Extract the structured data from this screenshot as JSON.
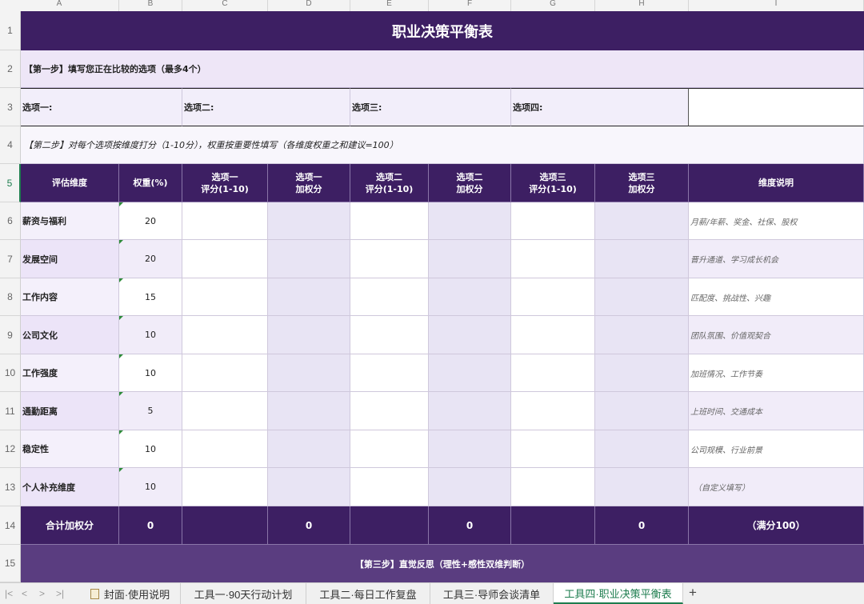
{
  "columns": [
    "A",
    "B",
    "C",
    "D",
    "E",
    "F",
    "G",
    "H",
    "I"
  ],
  "rows": [
    "1",
    "2",
    "3",
    "4",
    "5",
    "6",
    "7",
    "8",
    "9",
    "10",
    "11",
    "12",
    "13",
    "14",
    "15"
  ],
  "title": "职业决策平衡表",
  "step1": "【第一步】填写您正在比较的选项（最多4个）",
  "options": [
    "选项一:",
    "选项二:",
    "选项三:",
    "选项四:"
  ],
  "step2": "【第二步】对每个选项按维度打分（1-10分），权重按重要性填写（各维度权重之和建议=100）",
  "headers": {
    "dimension": "评估维度",
    "weight": "权重(%)",
    "opt1_score": "选项一\n评分(1-10)",
    "opt1_weighted": "选项一\n加权分",
    "opt2_score": "选项二\n评分(1-10)",
    "opt2_weighted": "选项二\n加权分",
    "opt3_score": "选项三\n评分(1-10)",
    "opt3_weighted": "选项三\n加权分",
    "description": "维度说明"
  },
  "dimensions": [
    {
      "name": "薪资与福利",
      "weight": "20",
      "desc": "月薪/年薪、奖金、社保、股权"
    },
    {
      "name": "发展空间",
      "weight": "20",
      "desc": "晋升通道、学习成长机会"
    },
    {
      "name": "工作内容",
      "weight": "15",
      "desc": "匹配度、挑战性、兴趣"
    },
    {
      "name": "公司文化",
      "weight": "10",
      "desc": "团队氛围、价值观契合"
    },
    {
      "name": "工作强度",
      "weight": "10",
      "desc": "加班情况、工作节奏"
    },
    {
      "name": "通勤距离",
      "weight": "5",
      "desc": "上班时间、交通成本"
    },
    {
      "name": "稳定性",
      "weight": "10",
      "desc": "公司规模、行业前景"
    },
    {
      "name": "个人补充维度",
      "weight": "10",
      "desc": "（自定义填写）"
    }
  ],
  "totals": {
    "label": "合计加权分",
    "weight": "0",
    "opt1": "0",
    "opt2": "0",
    "opt3": "0",
    "note": "（满分100）"
  },
  "step3": "【第三步】直觉反思（理性+感性双维判断）",
  "tabs": [
    "封面·使用说明",
    "工具一·90天行动计划",
    "工具二·每日工作复盘",
    "工具三·导师会谈清单",
    "工具四·职业决策平衡表"
  ],
  "active_tab": "工具四·职业决策平衡表",
  "colors": {
    "header_purple": "#3d1f63",
    "active_green": "#1e7d4f"
  }
}
